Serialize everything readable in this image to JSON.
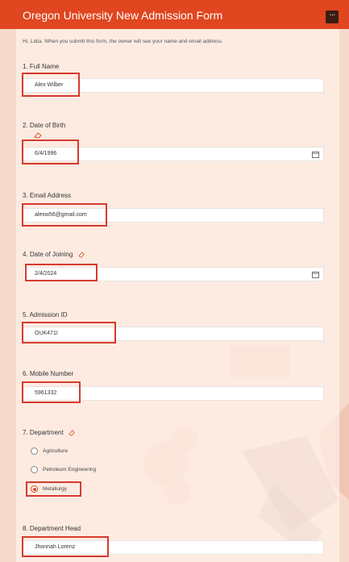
{
  "header": {
    "title": "Oregon University New Admission Form",
    "more_icon": "ellipsis-icon"
  },
  "intro": "Hi, Lidia. When you submit this form, the owner will see your name and email address.",
  "questions": [
    {
      "label": "1. Full Name",
      "value": "Alex Wilber"
    },
    {
      "label": "2. Date of Birth",
      "value": "6/4/1996"
    },
    {
      "label": "3. Email Address",
      "value": "alexw56@gmail.com"
    },
    {
      "label": "4. Date of Joining",
      "value": "2/4/2024"
    },
    {
      "label": "5. Admission ID",
      "value": "OUK471I"
    },
    {
      "label": "6. Mobile Number",
      "value": "5961332"
    },
    {
      "label": "7. Department",
      "options": [
        "Agriculture",
        "Petroleum Engineering",
        "Metallurgy"
      ],
      "selected": "Metallurgy"
    },
    {
      "label": "8. Department Head",
      "value": "Jhonnah Lorenz"
    }
  ],
  "colors": {
    "header": "#e0461f",
    "highlight": "#d63b2e",
    "background": "#f7d9cb"
  }
}
